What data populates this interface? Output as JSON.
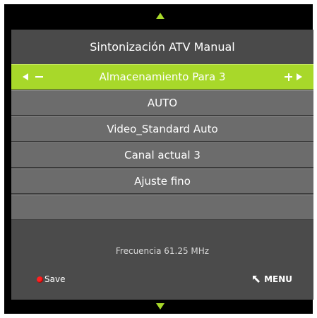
{
  "menu": {
    "title": "Sintonización ATV  Manual",
    "items": [
      {
        "label": "Almacenamiento Para 3",
        "selected": true
      },
      {
        "label": "AUTO",
        "selected": false
      },
      {
        "label": "Video_Standard Auto",
        "selected": false
      },
      {
        "label": "Canal actual 3",
        "selected": false
      },
      {
        "label": "Ajuste fino",
        "selected": false
      },
      {
        "label": "",
        "selected": false
      }
    ]
  },
  "status": {
    "frequency": "Frecuencia  61.25 MHz"
  },
  "footer": {
    "save_label": "Save",
    "menu_label": "MENU"
  },
  "colors": {
    "accent": "#a8d82a",
    "row_bg": "#6c6c6c",
    "panel_bg": "#4b4b4b",
    "save_dot": "#ff2020"
  },
  "icons": {
    "scroll_up": "triangle-up-icon",
    "scroll_down": "triangle-down-icon",
    "decrease": "arrow-left-minus-icon",
    "increase": "plus-arrow-right-icon",
    "save": "red-dot-icon",
    "back": "back-arrow-icon"
  }
}
